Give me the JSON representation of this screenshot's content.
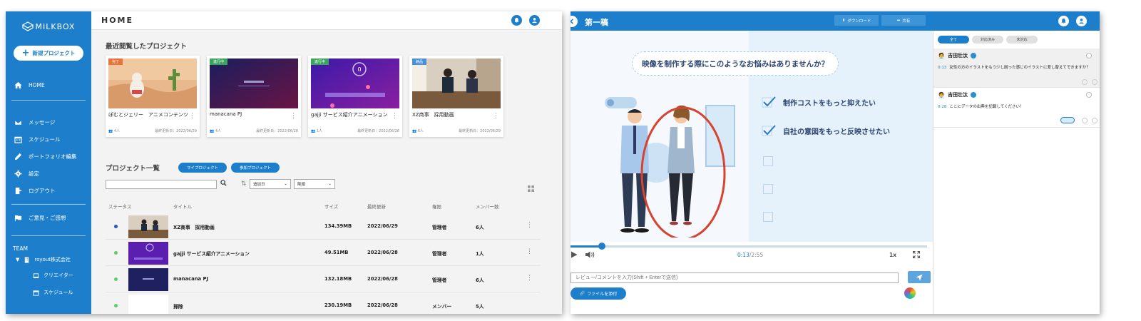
{
  "left": {
    "logo": "MILKBOX",
    "new_project": "新規プロジェクト",
    "nav": [
      {
        "label": "HOME",
        "icon": "home-icon"
      },
      {
        "label": "メッセージ",
        "icon": "mail-icon"
      },
      {
        "label": "スケジュール",
        "icon": "calendar-icon"
      },
      {
        "label": "ポートフォリオ編集",
        "icon": "pencil-icon"
      },
      {
        "label": "設定",
        "icon": "gear-icon"
      },
      {
        "label": "ログアウト",
        "icon": "logout-icon"
      },
      {
        "label": "ご意見・ご感想",
        "icon": "flag-icon"
      }
    ],
    "team": {
      "label": "TEAM",
      "org": "royout株式会社",
      "items": [
        {
          "label": "クリエイター",
          "icon": "laptop-icon"
        },
        {
          "label": "スケジュール",
          "icon": "calendar-icon"
        }
      ]
    },
    "page_title": "HOME",
    "recent_title": "最近閲覧したプロジェクト",
    "recent_cards": [
      {
        "badge": "完了",
        "badge_color": "#e8743b",
        "title": "ぽむとジェリー　アニメコンテンツ",
        "members": "4人",
        "updated": "最終更新日：2022/06/29"
      },
      {
        "badge": "進行中",
        "badge_color": "#3aa55c",
        "title": "manacana PJ",
        "members": "4人",
        "updated": "最終更新日：2022/06/28"
      },
      {
        "badge": "進行中",
        "badge_color": "#3aa55c",
        "title": "gajji サービス紹介アニメーション",
        "members": "1人",
        "updated": "最終更新日：2022/06/28"
      },
      {
        "badge": "納品",
        "badge_color": "#4a90d9",
        "title": "XZ商事　採用動画",
        "members": "6人",
        "updated": "最終更新日：2022/06/29"
      }
    ],
    "list_title": "プロジェクト一覧",
    "btn_my": "マイプロジェクト",
    "btn_joined": "参加プロジェクト",
    "sort1": "追加日",
    "sort2": "降順",
    "columns": [
      "ステータス",
      "タイトル",
      "サイズ",
      "最終更新",
      "権限",
      "メンバー数"
    ],
    "rows": [
      {
        "status_color": "#2453c7",
        "title": "XZ商事　採用動画",
        "size": "134.39MB",
        "updated": "2022/06/29",
        "role": "管理者",
        "members": "6人"
      },
      {
        "status_color": "#5cd065",
        "title": "gajji サービス紹介アニメーション",
        "size": "49.51MB",
        "updated": "2022/06/28",
        "role": "管理者",
        "members": "1人"
      },
      {
        "status_color": "#5cd065",
        "title": "manacana PJ",
        "size": "132.18MB",
        "updated": "2022/06/28",
        "role": "管理者",
        "members": "6人"
      },
      {
        "status_color": "#5cd065",
        "title": "掃除",
        "size": "230.19MB",
        "updated": "2022/06/28",
        "role": "メンバー",
        "members": "5人"
      }
    ]
  },
  "right": {
    "title": "第一稿",
    "download": "ダウンロード",
    "share": "共有",
    "question": "映像を制作する際にこのようなお悩みはありませんか？",
    "checks": [
      {
        "text": "制作コストをもっと抑えたい",
        "checked": true
      },
      {
        "text": "自社の意図をもっと反映させたい",
        "checked": true
      },
      {
        "text": "",
        "checked": false
      },
      {
        "text": "",
        "checked": false
      },
      {
        "text": "",
        "checked": false
      }
    ],
    "progress": 0.087,
    "time_current": "0:13",
    "time_total": "/2:55",
    "speed": "1x",
    "comment_placeholder": "レビュー/コメントを入力(Shift + Enterで送信)",
    "attach": "ファイルを添付",
    "filters": [
      "全て",
      "対応済み",
      "未対応"
    ],
    "comments": [
      {
        "user": "吉田壮汰",
        "time": "0:13",
        "text": "女性の方のイラストをもう少し困った感じのイラストに差し替えてできますか？"
      },
      {
        "user": "吉田壮汰",
        "time": "0:28",
        "text": "ここにデータの出典を記載してください！"
      }
    ]
  }
}
